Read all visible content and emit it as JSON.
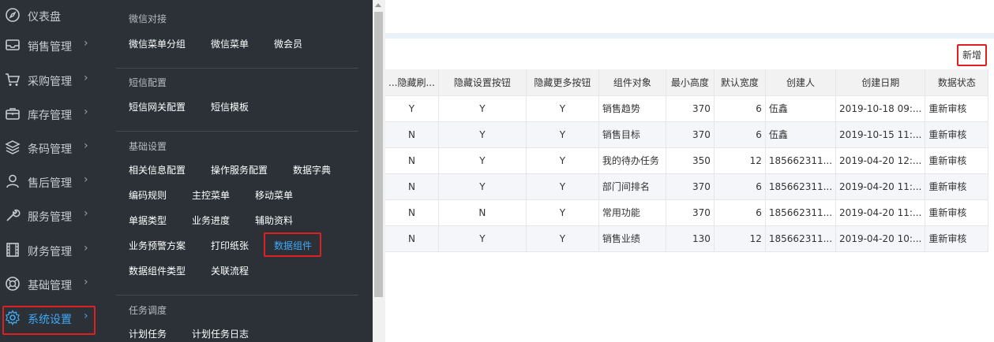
{
  "sidebar": {
    "items": [
      {
        "label": "仪表盘",
        "icon": "compass-icon",
        "chevron": false
      },
      {
        "label": "销售管理",
        "icon": "inbox-icon",
        "chevron": true
      },
      {
        "label": "采购管理",
        "icon": "cart-icon",
        "chevron": true
      },
      {
        "label": "库存管理",
        "icon": "briefcase-icon",
        "chevron": true
      },
      {
        "label": "条码管理",
        "icon": "layers-icon",
        "chevron": true
      },
      {
        "label": "售后管理",
        "icon": "user-icon",
        "chevron": true
      },
      {
        "label": "服务管理",
        "icon": "wrench-icon",
        "chevron": true
      },
      {
        "label": "财务管理",
        "icon": "film-icon",
        "chevron": true
      },
      {
        "label": "基础管理",
        "icon": "lifebuoy-icon",
        "chevron": true
      },
      {
        "label": "系统设置",
        "icon": "gear-icon",
        "chevron": true,
        "active": true
      }
    ],
    "chevron_glyph": "›"
  },
  "flyout": {
    "sections": [
      {
        "title": "微信对接",
        "links": [
          "微信菜单分组",
          "微信菜单",
          "微会员"
        ]
      },
      {
        "title": "短信配置",
        "links": [
          "短信网关配置",
          "短信模板"
        ]
      },
      {
        "title": "基础设置",
        "links": [
          "相关信息配置",
          "操作服务配置",
          "数据字典",
          "编码规则",
          "主控菜单",
          "移动菜单",
          "单据类型",
          "业务进度",
          "辅助资料",
          "业务预警方案",
          "打印纸张",
          "数据组件",
          "数据组件类型",
          "关联流程"
        ],
        "active_link": "数据组件"
      },
      {
        "title": "任务调度",
        "links": [
          "计划任务",
          "计划任务日志"
        ]
      }
    ]
  },
  "toolbar": {
    "add_label": "新增"
  },
  "table": {
    "headers": [
      "...隐藏刷...",
      "隐藏设置按钮",
      "隐藏更多按钮",
      "组件对象",
      "最小高度",
      "默认宽度",
      "创建人",
      "创建日期",
      "数据状态"
    ],
    "rows": [
      [
        "Y",
        "Y",
        "Y",
        "销售趋势",
        "370",
        "6",
        "伍鑫",
        "2019-10-18 09:...",
        "重新审核"
      ],
      [
        "N",
        "Y",
        "Y",
        "销售目标",
        "370",
        "6",
        "伍鑫",
        "2019-10-15 11:...",
        "重新审核"
      ],
      [
        "N",
        "Y",
        "Y",
        "我的待办任务",
        "350",
        "12",
        "185662311...",
        "2019-04-20 12:...",
        "重新审核"
      ],
      [
        "N",
        "Y",
        "Y",
        "部门间排名",
        "370",
        "6",
        "185662311...",
        "2019-04-20 11:...",
        "重新审核"
      ],
      [
        "N",
        "N",
        "Y",
        "常用功能",
        "370",
        "6",
        "185662311...",
        "2019-04-20 11:...",
        "重新审核"
      ],
      [
        "N",
        "Y",
        "Y",
        "销售业绩",
        "130",
        "12",
        "185662311...",
        "2019-04-20 10:...",
        "重新审核"
      ]
    ]
  },
  "colors": {
    "sidebar_bg": "#2b3137",
    "accent": "#3fa9f5",
    "highlight_frame": "#e02020"
  }
}
